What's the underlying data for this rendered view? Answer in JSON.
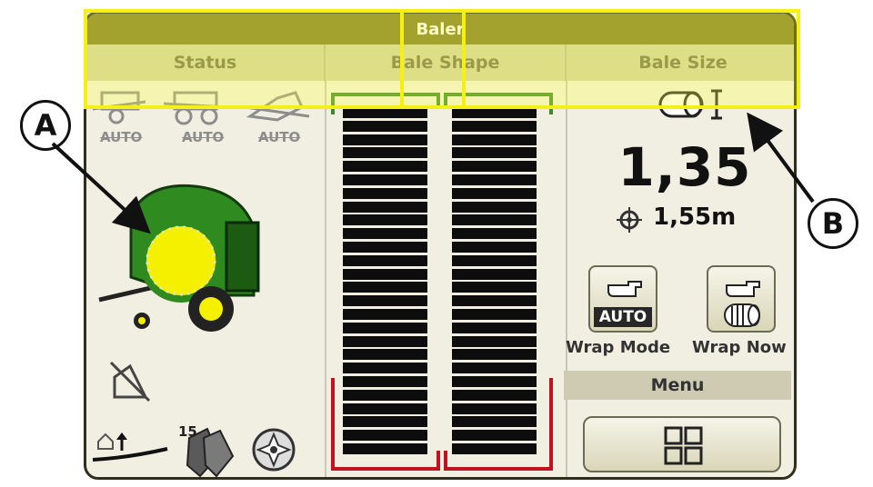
{
  "header": {
    "title": "Baler"
  },
  "columns": {
    "status": "Status",
    "bale_shape": "Bale Shape",
    "bale_size": "Bale Size"
  },
  "status_panel": {
    "auto_labels": [
      "AUTO",
      "AUTO",
      "AUTO"
    ],
    "counter_value": "15"
  },
  "bale_size": {
    "value": "1,35",
    "target": "1,55m"
  },
  "buttons": {
    "wrap_mode_auto": "AUTO",
    "wrap_mode_label": "Wrap Mode",
    "wrap_now_label": "Wrap Now",
    "menu_label": "Menu"
  },
  "callouts": {
    "a": "A",
    "b": "B"
  },
  "colors": {
    "header": "#7d7a2a",
    "deere_green": "#2f8a1f",
    "bale_yellow": "#f4f000",
    "shape_green": "#3a8a2a",
    "shape_red": "#c1121f",
    "highlight": "#f5ef12"
  }
}
